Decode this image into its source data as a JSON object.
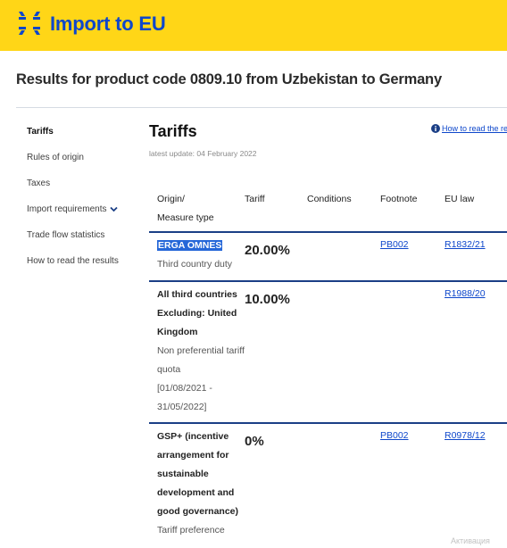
{
  "header": {
    "app_title": "Import to EU",
    "accent_color": "#ffd617",
    "brand_color": "#0e47cb",
    "logo_icon": "eu-arrows-logo"
  },
  "results_heading": "Results for product code 0809.10 from Uzbekistan to Germany",
  "sidebar": {
    "items": [
      {
        "label": "Tariffs",
        "active": true
      },
      {
        "label": "Rules of origin"
      },
      {
        "label": "Taxes"
      },
      {
        "label": "Import requirements",
        "icon": "chevron-down-icon"
      },
      {
        "label": "Trade flow statistics"
      },
      {
        "label": "How to read the results"
      }
    ]
  },
  "main": {
    "title": "Tariffs",
    "latest_update": "latest update: 04 February 2022",
    "how_to_read_link": "How to read the results",
    "columns": {
      "origin_line1": "Origin/",
      "origin_line2": "Measure type",
      "tariff": "Tariff",
      "conditions": "Conditions",
      "footnote": "Footnote",
      "eu_law": "EU law"
    },
    "rows": [
      {
        "origin": "ERGA OMNES",
        "measure_type": "Third country duty",
        "tariff": "20.00%",
        "footnote": "PB002",
        "eu_law": "R1832/21"
      },
      {
        "origin_lines": [
          "All third countries",
          "Excluding: United",
          "Kingdom"
        ],
        "measure_type_lines": [
          "Non preferential tariff",
          "quota",
          "[01/08/2021 -",
          "31/05/2022]"
        ],
        "tariff": "10.00%",
        "eu_law": "R1988/20"
      },
      {
        "origin_lines": [
          "GSP+ (incentive",
          "arrangement for",
          "sustainable",
          "development and",
          "good governance)"
        ],
        "measure_type": "Tariff preference",
        "tariff": "0%",
        "footnote": "PB002",
        "eu_law": "R0978/12"
      }
    ]
  },
  "watermark": "Активация"
}
